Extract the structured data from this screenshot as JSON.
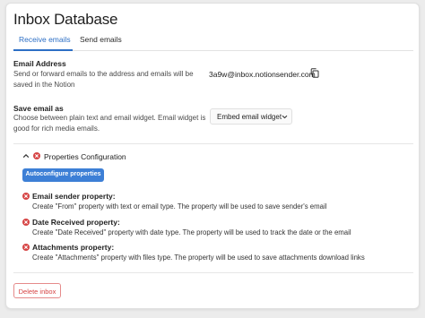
{
  "page": {
    "title": "Inbox Database"
  },
  "tabs": [
    {
      "label": "Receive emails",
      "active": true
    },
    {
      "label": "Send emails",
      "active": false
    }
  ],
  "email_address": {
    "label": "Email Address",
    "description_line1": "Send or forward emails to the address and emails will be",
    "description_line2": "saved in the Notion",
    "value": "3a9w@inbox.notionsender.com",
    "copy_icon": "copy-icon"
  },
  "save_email_as": {
    "label": "Save email as",
    "description_line1": "Choose between plain text and email widget. Email widget is",
    "description_line2": "good for rich media emails.",
    "selected": "Embed email widget"
  },
  "properties_config": {
    "title": "Properties Configuration",
    "expanded": true,
    "autoconfigure_label": "Autoconfigure properties",
    "items": [
      {
        "title": "Email sender property:",
        "description": "Create \"From\" property with text or email type. The property will be used to save sender's email",
        "status_icon": "error-icon"
      },
      {
        "title": "Date Received property:",
        "description": "Create \"Date Received\" property with date type. The property will be used to track the date or the email",
        "status_icon": "error-icon"
      },
      {
        "title": "Attachments property:",
        "description": "Create \"Attachments\" property with files type. The property will be used to save attachments download links",
        "status_icon": "error-icon"
      }
    ]
  },
  "actions": {
    "delete_label": "Delete inbox"
  },
  "colors": {
    "accent": "#2d6fc5",
    "button": "#3d7fd6",
    "error": "#d64545"
  }
}
